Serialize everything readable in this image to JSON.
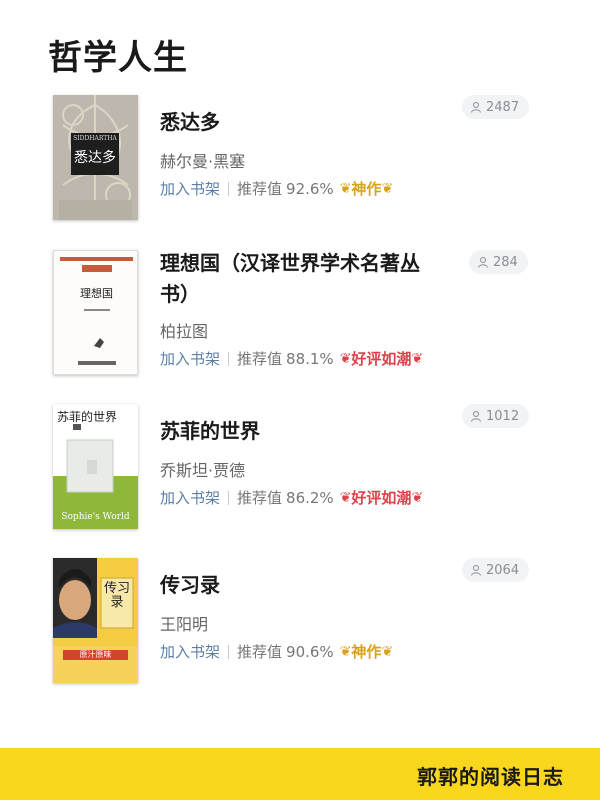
{
  "page": {
    "title": "哲学人生"
  },
  "books": [
    {
      "title": "悉达多",
      "author": "赫尔曼·黑塞",
      "add_label": "加入书架",
      "score_label": "推荐值",
      "score": "92.6%",
      "badge": "神作",
      "badge_color": "#d9a21b",
      "readers": "2487",
      "cover_text": {
        "title": "悉达多",
        "subtitle": "SIDDHARTHA"
      }
    },
    {
      "title": "理想国（汉译世界学术名著丛书）",
      "author": "柏拉图",
      "add_label": "加入书架",
      "score_label": "推荐值",
      "score": "88.1%",
      "badge": "好评如潮",
      "badge_color": "#e0404a",
      "readers": "284",
      "cover_text": {
        "title": "理想国"
      }
    },
    {
      "title": "苏菲的世界",
      "author": "乔斯坦·贾德",
      "add_label": "加入书架",
      "score_label": "推荐值",
      "score": "86.2%",
      "badge": "好评如潮",
      "badge_color": "#e0404a",
      "readers": "1012",
      "cover_text": {
        "title": "苏菲的世界",
        "subtitle": "Sophie's World"
      }
    },
    {
      "title": "传习录",
      "author": "王阳明",
      "add_label": "加入书架",
      "score_label": "推荐值",
      "score": "90.6%",
      "badge": "神作",
      "badge_color": "#d9a21b",
      "readers": "2064",
      "cover_text": {
        "title": "传习录",
        "subtitle": "原汁原味"
      }
    }
  ],
  "footer": {
    "text": "郭郭的阅读日志",
    "color": "#f9d71c"
  }
}
